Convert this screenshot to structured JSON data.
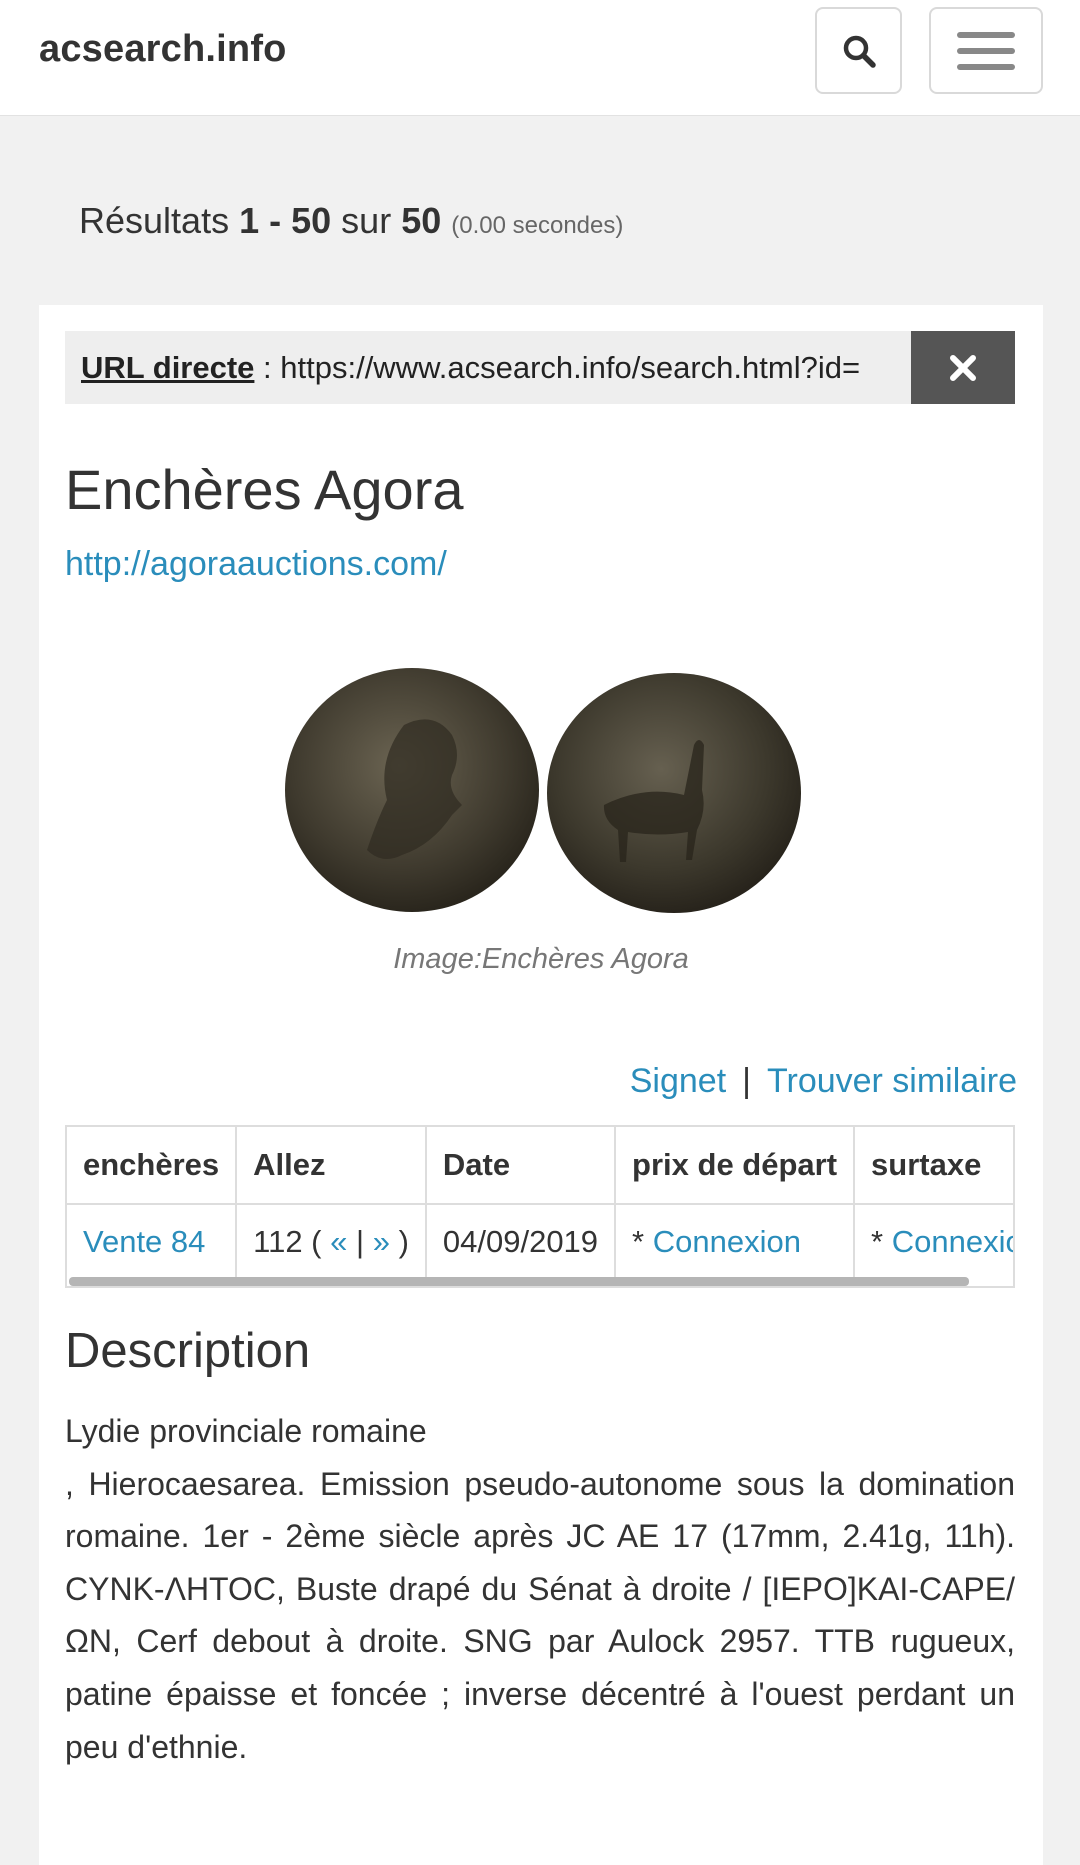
{
  "navbar": {
    "brand": "acsearch.info",
    "search_icon": "search-icon",
    "menu_icon": "hamburger-menu-icon"
  },
  "results": {
    "prefix": "Résultats",
    "range": "1 - 50",
    "sur": "sur",
    "total": "50",
    "time": "(0.00 secondes)"
  },
  "direct_url": {
    "label": "URL directe",
    "separator": " : ",
    "value": "https://www.acsearch.info/search.html?id=",
    "close_icon": "close-icon"
  },
  "lot": {
    "auction_house": "Enchères Agora",
    "website": "http://agoraauctions.com/",
    "image_caption": "Image:Enchères Agora",
    "bookmark": "Signet",
    "separator": "|",
    "find_similar": "Trouver similaire"
  },
  "table": {
    "headers": [
      "enchères",
      "Allez",
      "Date",
      "prix de départ",
      "surtaxe"
    ],
    "row": {
      "sale": "Vente 84",
      "lot_number": "112 (",
      "prev": "«",
      "pipe": "|",
      "next": "»",
      "close_paren": ")",
      "date": "04/09/2019",
      "price_prefix": "* ",
      "price_link": "Connexion",
      "fee_prefix": "* ",
      "fee_link": "Connexion"
    }
  },
  "description": {
    "title": "Description",
    "line1": "Lydie provinciale romaine",
    "body": ", Hierocaesarea. Emission pseudo-autonome sous la domination romaine. 1er - 2ème siècle après JC AE 17 (17mm, 2.41g, 11h). CYNK-ΛΗΤΟC, Buste drapé du Sénat à droite / [IEPO]KAI-CAPE/ΩN, Cerf debout à droite. SNG par Aulock 2957. TTB rugueux, patine épaisse et foncée ; inverse décentré à l'ouest perdant un peu d'ethnie."
  },
  "colors": {
    "link": "#2a8dbb",
    "background": "#f1f1f1",
    "close_button": "#555555"
  }
}
